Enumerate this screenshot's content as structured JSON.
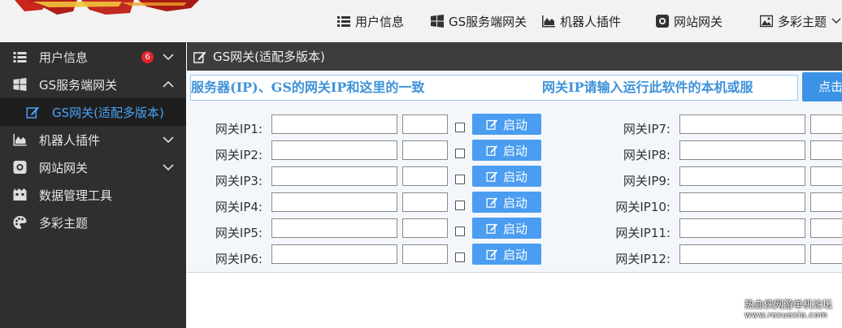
{
  "topnav": {
    "items": [
      {
        "label": "用户信息",
        "icon": "list-icon"
      },
      {
        "label": "GS服务端网关",
        "icon": "windows-icon"
      },
      {
        "label": "机器人插件",
        "icon": "area-chart-icon"
      },
      {
        "label": "网站网关",
        "icon": "camera-icon"
      },
      {
        "label": "多彩主题",
        "icon": "image-icon"
      }
    ]
  },
  "sidebar": {
    "items": [
      {
        "label": "用户信息",
        "badge": "6",
        "icon": "list-icon"
      },
      {
        "label": "GS服务端网关",
        "icon": "windows-icon"
      },
      {
        "label": "GS网关(适配多版本)",
        "icon": "edit-icon"
      },
      {
        "label": "机器人插件",
        "icon": "area-chart-icon"
      },
      {
        "label": "网站网关",
        "icon": "camera-icon"
      },
      {
        "label": "数据管理工具",
        "icon": "film-icon"
      },
      {
        "label": "多彩主题",
        "icon": "palette-icon"
      }
    ]
  },
  "panel": {
    "title": "GS网关(适配多版本)",
    "marquee_1": "服务器(IP)、GS的网关IP和这里的一致",
    "marquee_2": "网关IP请输入运行此软件的本机或服",
    "click_button": "点击"
  },
  "gateways_left": [
    {
      "label": "网关IP1:",
      "button": "启动"
    },
    {
      "label": "网关IP2:",
      "button": "启动"
    },
    {
      "label": "网关IP3:",
      "button": "启动"
    },
    {
      "label": "网关IP4:",
      "button": "启动"
    },
    {
      "label": "网关IP5:",
      "button": "启动"
    },
    {
      "label": "网关IP6:",
      "button": "启动"
    }
  ],
  "gateways_right": [
    {
      "label": "网关IP7:"
    },
    {
      "label": "网关IP8:"
    },
    {
      "label": "网关IP9:"
    },
    {
      "label": "网关IP10:"
    },
    {
      "label": "网关IP11:"
    },
    {
      "label": "网关IP12:"
    }
  ],
  "watermark": {
    "line1": "热血侠网游单机论坛",
    "line2": "www.rexuexia.com"
  },
  "colors": {
    "accent": "#4a9df0",
    "sidebar_bg": "#2f2f2f",
    "badge": "#e0262b"
  }
}
